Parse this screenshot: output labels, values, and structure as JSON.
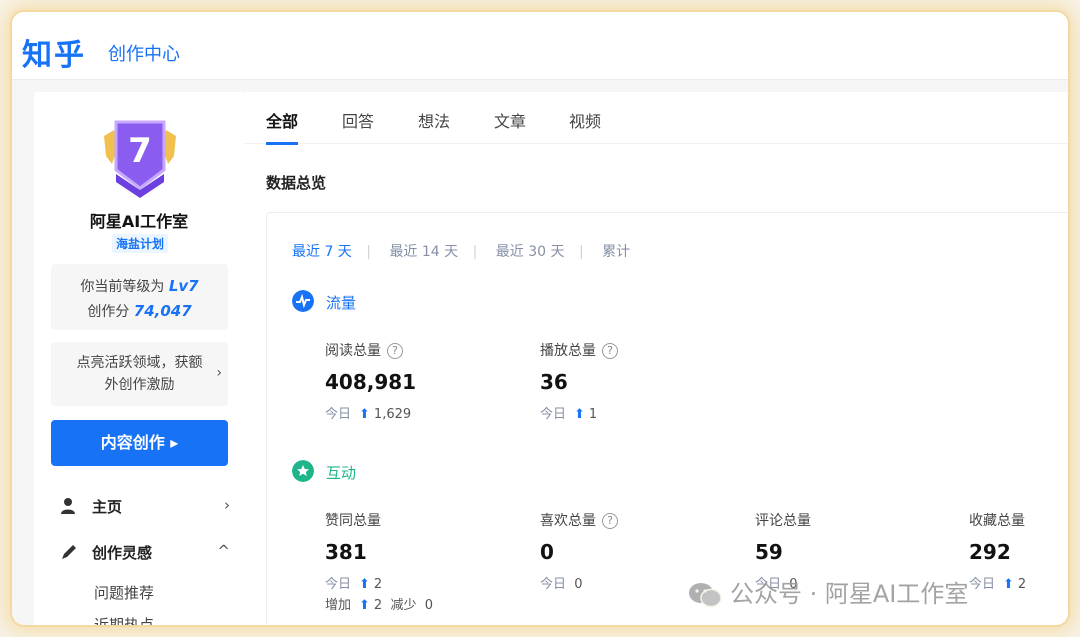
{
  "header": {
    "logo": "知乎",
    "subtitle": "创作中心"
  },
  "sidebar": {
    "badge_level": "7",
    "username": "阿星AI工作室",
    "plan": "海盐计划",
    "level_text": "你当前等级为",
    "level_value": "Lv7",
    "score_text": "创作分",
    "score_value": "74,047",
    "tip_line1": "点亮活跃领域，获额",
    "tip_line2": "外创作激励",
    "tip_chevron": "›",
    "create_button": "内容创作 ▸",
    "nav": [
      {
        "label": "主页",
        "chevron": "›"
      },
      {
        "label": "创作灵感",
        "chevron": "^"
      }
    ],
    "subnav": [
      "问题推荐",
      "近期热点"
    ]
  },
  "tabs": [
    "全部",
    "回答",
    "想法",
    "文章",
    "视频"
  ],
  "section_title": "数据总览",
  "ranges": [
    "最近 7 天",
    "最近 14 天",
    "最近 30 天",
    "累计"
  ],
  "range_separator": "|",
  "groups": {
    "traffic": {
      "label": "流量",
      "color": "#1772f6"
    },
    "interaction": {
      "label": "互动",
      "color": "#1fb58b"
    }
  },
  "metrics_traffic": [
    {
      "label": "阅读总量",
      "help": "?",
      "value": "408,981",
      "today_label": "今日",
      "today_value": "1,629"
    },
    {
      "label": "播放总量",
      "help": "?",
      "value": "36",
      "today_label": "今日",
      "today_value": "1"
    }
  ],
  "metrics_interaction": [
    {
      "label": "赞同总量",
      "value": "381",
      "today_label": "今日",
      "today_value": "2",
      "add_label": "增加",
      "add_value": "2",
      "reduce_label": "减少",
      "reduce_value": "0"
    },
    {
      "label": "喜欢总量",
      "help": "?",
      "value": "0",
      "today_label": "今日",
      "today_value": "0"
    },
    {
      "label": "评论总量",
      "value": "59",
      "today_label": "今日",
      "today_value": "0"
    },
    {
      "label": "收藏总量",
      "value": "292",
      "today_label": "今日",
      "today_value": "2"
    }
  ],
  "watermark": "公众号 · 阿星AI工作室"
}
